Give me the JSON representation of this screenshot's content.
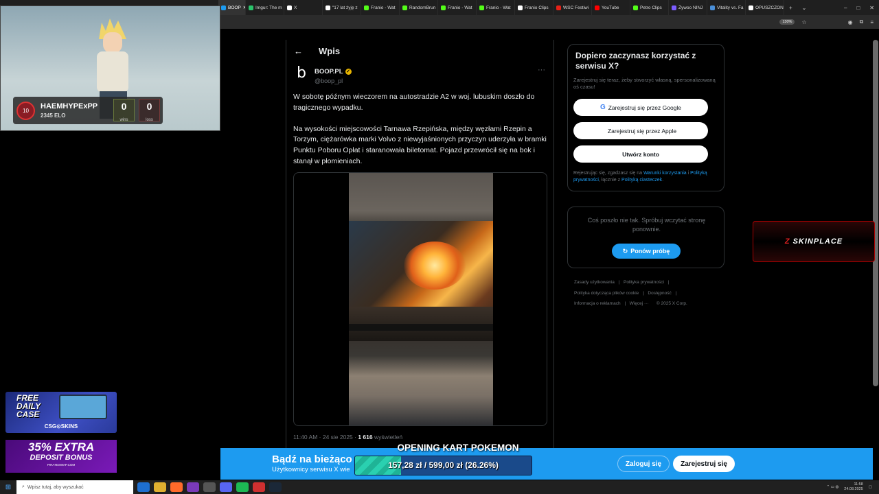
{
  "browser": {
    "tabs": [
      {
        "label": "BOOP",
        "active": true,
        "color": "#1d9bf0"
      },
      {
        "label": "Imgur: The m",
        "active": false,
        "color": "#2bc36b"
      },
      {
        "label": "X",
        "active": false,
        "color": "#ffffff"
      },
      {
        "label": "\"17 lat żyję z",
        "active": false,
        "color": "#ffffff"
      },
      {
        "label": "Franio - Wat",
        "active": false,
        "color": "#53fc18"
      },
      {
        "label": "RandomBrun",
        "active": false,
        "color": "#53fc18"
      },
      {
        "label": "Franio - Wat",
        "active": false,
        "color": "#53fc18"
      },
      {
        "label": "Franio - Wat",
        "active": false,
        "color": "#53fc18"
      },
      {
        "label": "Franio Clips",
        "active": false,
        "color": "#ffffff"
      },
      {
        "label": "WSC Festiwi",
        "active": false,
        "color": "#e62117"
      },
      {
        "label": "YouTube",
        "active": false,
        "color": "#ff0000"
      },
      {
        "label": "Petro Clips",
        "active": false,
        "color": "#53fc18"
      },
      {
        "label": "Żywoo NINJ",
        "active": false,
        "color": "#7b5cff"
      },
      {
        "label": "Vitality vs. Fa",
        "active": false,
        "color": "#4a8fd8"
      },
      {
        "label": "OPUSZCZON",
        "active": false,
        "color": "#ffffff"
      }
    ],
    "zoom": "130%"
  },
  "post": {
    "header_title": "Wpis",
    "author_name": "BOOP.PL",
    "author_handle": "@boop_pl",
    "avatar_letter": "b",
    "paragraphs": [
      "W sobotę późnym wieczorem na autostradzie A2 w woj. lubuskim doszło do tragicznego wypadku.",
      "Na wysokości miejscowości Tarnawa Rzepińska, między węzłami Rzepin a Torzym, ciężarówka marki Volvo z niewyjaśnionych przyczyn uderzyła w bramki Punktu Poboru Opłat i staranowała biletomat. Pojazd przewrócił się na bok i stanął w płomieniach."
    ],
    "time": "11:40 AM · 24 sie 2025 · ",
    "views_count": "1 616",
    "views_label": " wyświetleń"
  },
  "sidebar": {
    "title": "Dopiero zaczynasz korzystać z serwisu X?",
    "description": "Zarejestruj się teraz, żeby stworzyć własną, spersonalizowaną oś czasu!",
    "google_button": "Zarejestruj się przez Google",
    "apple_button": "Zarejestruj się przez Apple",
    "create_button": "Utwórz konto",
    "legal_prefix": "Rejestrując się, zgadzasz się na ",
    "terms_link": "Warunki korzystania",
    "legal_mid1": " i ",
    "privacy_link": "Polityką prywatności",
    "legal_mid2": ", łącznie z ",
    "cookies_link": "Polityką ciasteczek",
    "legal_end": "."
  },
  "error_box": {
    "message": "Coś poszło nie tak. Spróbuj wczytać stronę ponownie.",
    "retry_button": "Ponów próbę"
  },
  "footer": {
    "links": [
      "Zasady użytkowania",
      "Polityka prywatności",
      "Polityka dotycząca plików cookie",
      "Dostępność",
      "Informacja o reklamach",
      "Więcej ···",
      "© 2025 X Corp."
    ]
  },
  "overlay": {
    "player_name": "HAEMHYPExPP",
    "elo": "2345 ELO",
    "level": "10",
    "wins_value": "0",
    "wins_label": "wins",
    "losses_value": "0",
    "losses_label": "loss",
    "skinplace_label": "SKINPLACE",
    "ad1_line1": "FREE",
    "ad1_line2": "DAILY",
    "ad1_line3": "CASE",
    "ad1_brand": "CSG⊙SKINS",
    "ad2_line1": "35% EXTRA",
    "ad2_line2": "DEPOSIT BONUS",
    "ad2_brand": "PIRATESWAP.COM",
    "goal_title": "OPENING KART POKEMON",
    "goal_text": "157,28 zł / 599,00 zł (26.26%)",
    "goal_fraction": 0.2626
  },
  "bottom_banner": {
    "title": "Bądź na bieżąco",
    "subtitle": "Użytkownicy serwisu X wie",
    "login": "Zaloguj się",
    "signup": "Zarejestruj się"
  },
  "taskbar": {
    "search_placeholder": "Wpisz tutaj, aby wyszukać",
    "time": "11:58",
    "date": "24.08.2025"
  }
}
